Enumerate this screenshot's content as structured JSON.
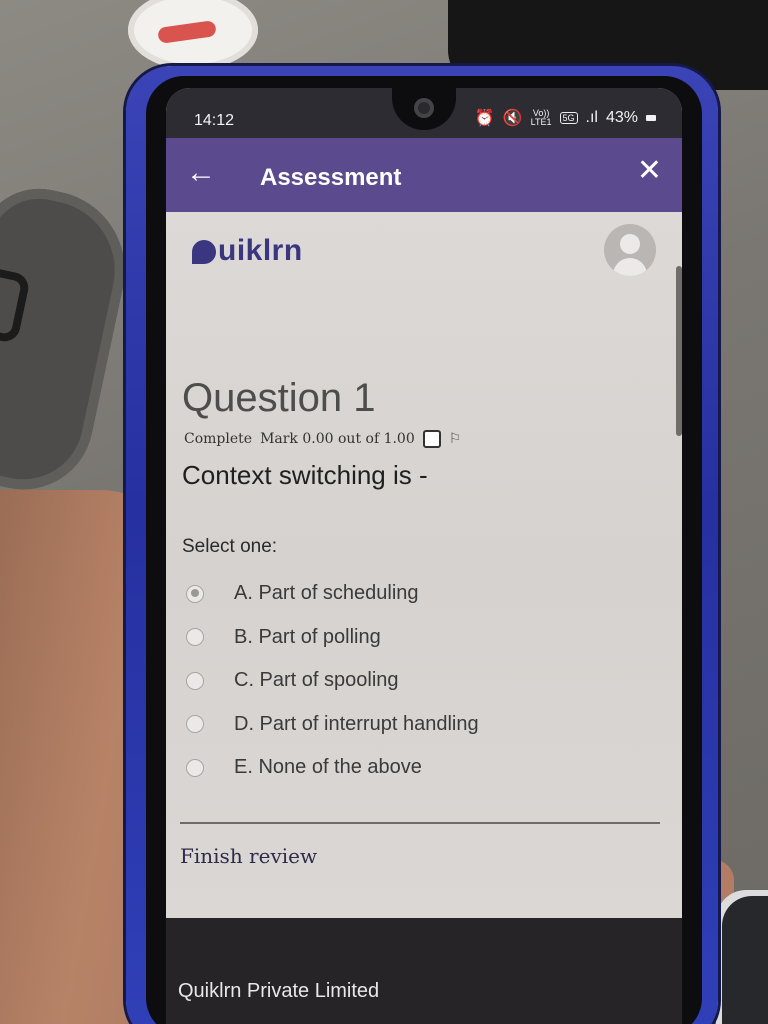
{
  "status_bar": {
    "time": "14:12",
    "volte_label": "Vo))",
    "lte_label": "LTE1",
    "network_label": "5G",
    "signal_label": ".ıl",
    "battery_percent": "43%"
  },
  "app_bar": {
    "title": "Assessment",
    "color": "#5b4a8e"
  },
  "brand": {
    "logo_text": "uiklrn",
    "logo_color": "#3a3780"
  },
  "question": {
    "heading": "Question 1",
    "state": "Complete",
    "mark": "Mark 0.00 out of 1.00",
    "text": "Context switching is -",
    "select_label": "Select one:",
    "selected_index": 0,
    "options": [
      {
        "label": "A. Part of scheduling"
      },
      {
        "label": "B. Part of polling"
      },
      {
        "label": "C. Part of spooling"
      },
      {
        "label": "D. Part of interrupt handling"
      },
      {
        "label": "E. None of the above"
      }
    ]
  },
  "navigation": {
    "finish_review": "Finish review"
  },
  "footer": {
    "company": "Quiklrn Private Limited"
  },
  "icons": [
    "back-arrow-icon",
    "close-icon",
    "user-avatar-icon",
    "flag-icon",
    "battery-icon",
    "signal-icon"
  ]
}
